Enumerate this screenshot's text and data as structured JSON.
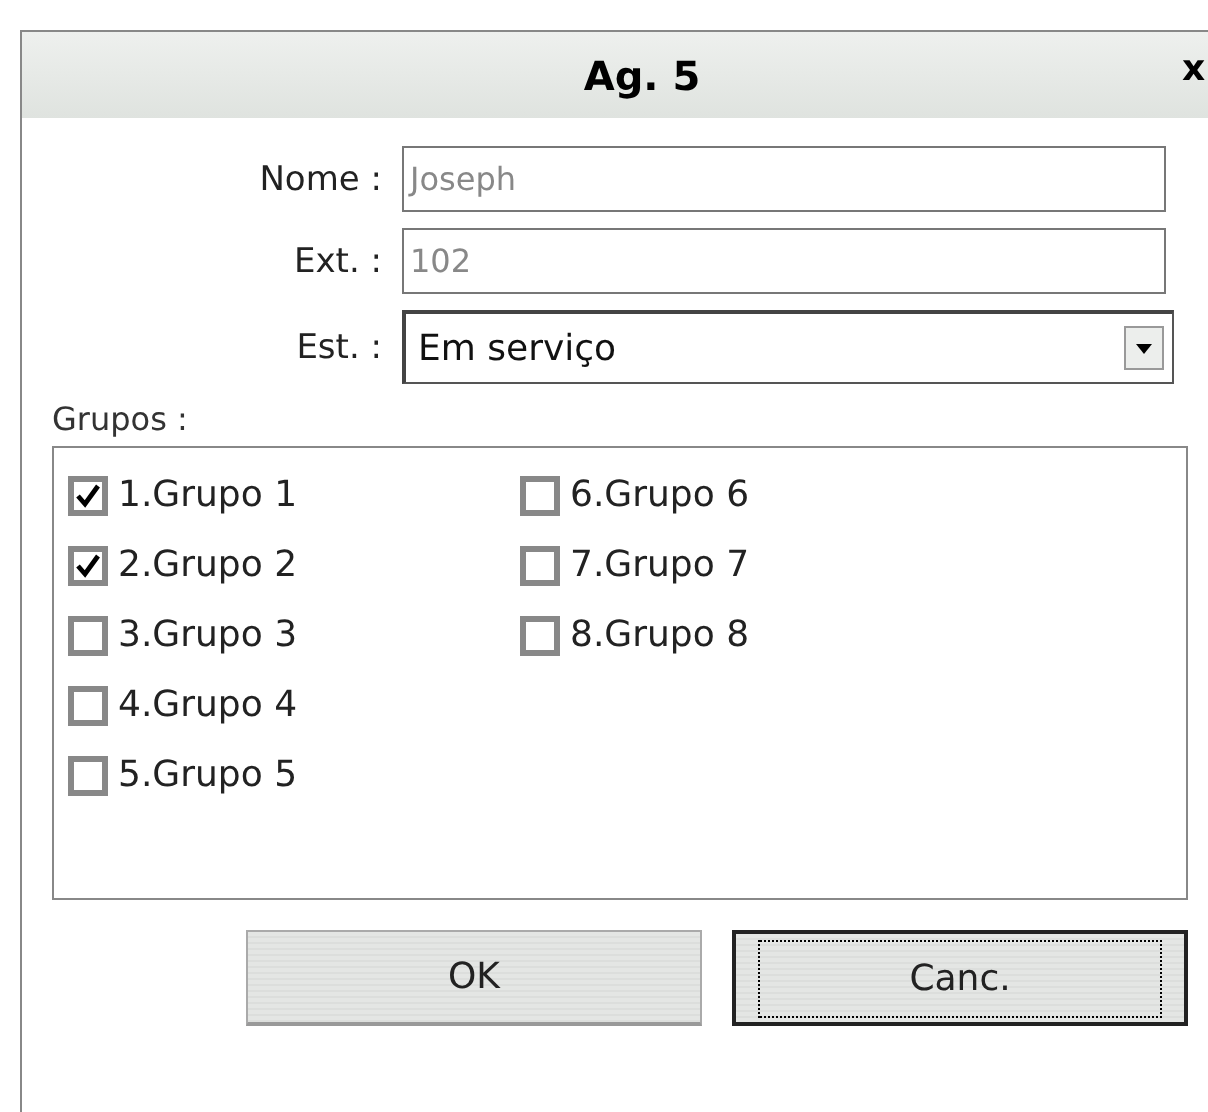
{
  "dialog": {
    "title": "Ag. 5",
    "close": "x"
  },
  "fields": [
    {
      "kind": "text",
      "label": "Nome :",
      "value": "Joseph"
    },
    {
      "kind": "text",
      "label": "Ext. :",
      "value": "102"
    },
    {
      "kind": "select",
      "label": "Est. :",
      "value": "Em serviço"
    }
  ],
  "groups": {
    "label": "Grupos :",
    "items": [
      {
        "label": "1.Grupo 1",
        "checked": true
      },
      {
        "label": "2.Grupo 2",
        "checked": true
      },
      {
        "label": "3.Grupo 3",
        "checked": false
      },
      {
        "label": "4.Grupo 4",
        "checked": false
      },
      {
        "label": "5.Grupo 5",
        "checked": false
      },
      {
        "label": "6.Grupo 6",
        "checked": false
      },
      {
        "label": "7.Grupo 7",
        "checked": false
      },
      {
        "label": "8.Grupo 8",
        "checked": false
      }
    ]
  },
  "buttons": [
    {
      "label": "OK",
      "focused": false
    },
    {
      "label": "Canc.",
      "focused": true
    }
  ]
}
